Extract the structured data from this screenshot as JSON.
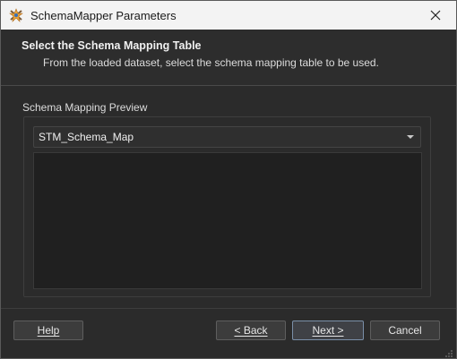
{
  "window": {
    "title": "SchemaMapper Parameters",
    "icon": "fme-workbench-icon",
    "close_icon": "close-icon"
  },
  "header": {
    "title": "Select the Schema Mapping Table",
    "subtitle": "From the loaded dataset, select the schema mapping table to be used."
  },
  "main": {
    "section_label": "Schema Mapping Preview",
    "table_select": {
      "selected": "STM_Schema_Map"
    }
  },
  "footer": {
    "help_label": "Help",
    "back_label": "< Back",
    "next_label": "Next >",
    "cancel_label": "Cancel"
  },
  "colors": {
    "window_bg": "#2b2b2b",
    "titlebar_bg": "#f3f3f3",
    "preview_bg": "#202020",
    "default_button_border": "#7a8fa8"
  }
}
